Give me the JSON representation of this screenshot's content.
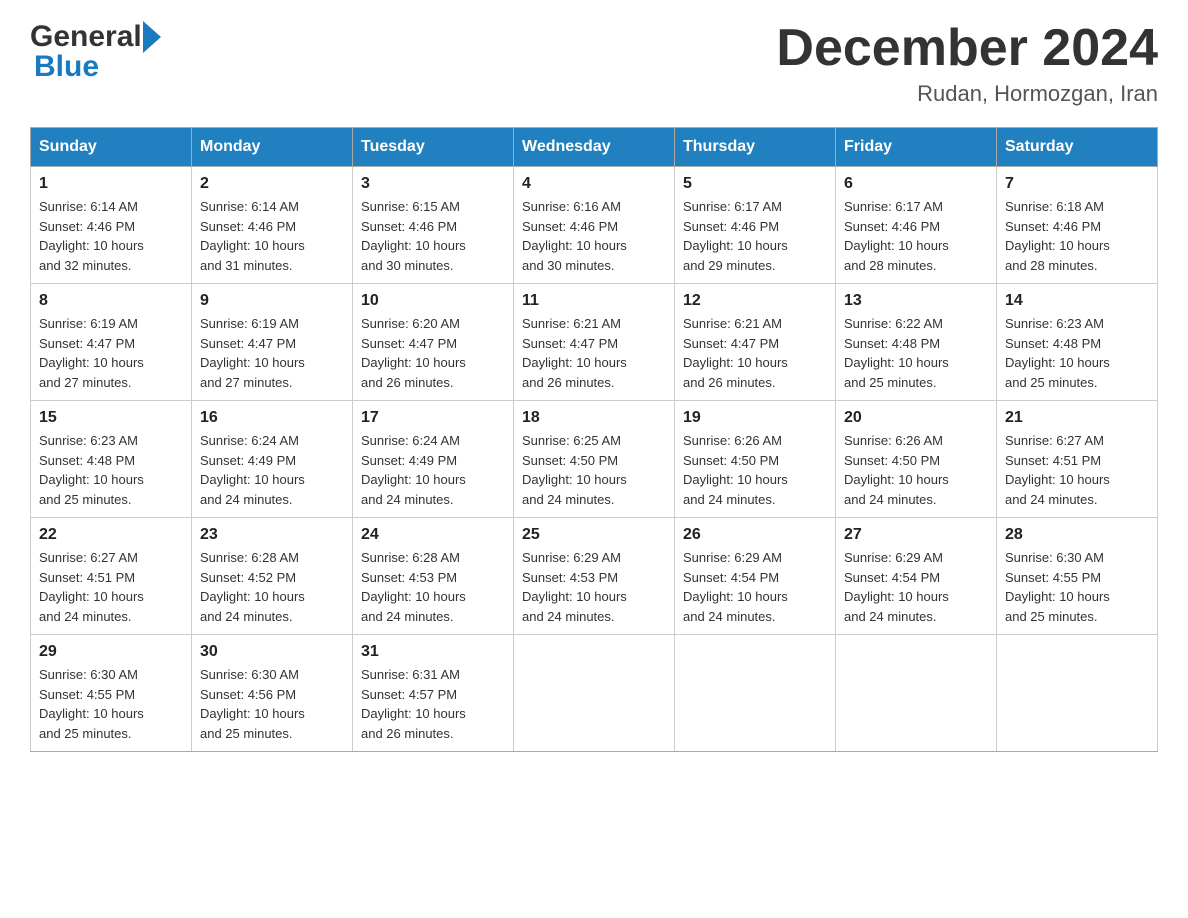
{
  "logo": {
    "general": "General",
    "blue": "Blue"
  },
  "title": {
    "month_year": "December 2024",
    "location": "Rudan, Hormozgan, Iran"
  },
  "weekdays": [
    "Sunday",
    "Monday",
    "Tuesday",
    "Wednesday",
    "Thursday",
    "Friday",
    "Saturday"
  ],
  "weeks": [
    [
      {
        "day": "1",
        "sunrise": "6:14 AM",
        "sunset": "4:46 PM",
        "daylight": "10 hours and 32 minutes."
      },
      {
        "day": "2",
        "sunrise": "6:14 AM",
        "sunset": "4:46 PM",
        "daylight": "10 hours and 31 minutes."
      },
      {
        "day": "3",
        "sunrise": "6:15 AM",
        "sunset": "4:46 PM",
        "daylight": "10 hours and 30 minutes."
      },
      {
        "day": "4",
        "sunrise": "6:16 AM",
        "sunset": "4:46 PM",
        "daylight": "10 hours and 30 minutes."
      },
      {
        "day": "5",
        "sunrise": "6:17 AM",
        "sunset": "4:46 PM",
        "daylight": "10 hours and 29 minutes."
      },
      {
        "day": "6",
        "sunrise": "6:17 AM",
        "sunset": "4:46 PM",
        "daylight": "10 hours and 28 minutes."
      },
      {
        "day": "7",
        "sunrise": "6:18 AM",
        "sunset": "4:46 PM",
        "daylight": "10 hours and 28 minutes."
      }
    ],
    [
      {
        "day": "8",
        "sunrise": "6:19 AM",
        "sunset": "4:47 PM",
        "daylight": "10 hours and 27 minutes."
      },
      {
        "day": "9",
        "sunrise": "6:19 AM",
        "sunset": "4:47 PM",
        "daylight": "10 hours and 27 minutes."
      },
      {
        "day": "10",
        "sunrise": "6:20 AM",
        "sunset": "4:47 PM",
        "daylight": "10 hours and 26 minutes."
      },
      {
        "day": "11",
        "sunrise": "6:21 AM",
        "sunset": "4:47 PM",
        "daylight": "10 hours and 26 minutes."
      },
      {
        "day": "12",
        "sunrise": "6:21 AM",
        "sunset": "4:47 PM",
        "daylight": "10 hours and 26 minutes."
      },
      {
        "day": "13",
        "sunrise": "6:22 AM",
        "sunset": "4:48 PM",
        "daylight": "10 hours and 25 minutes."
      },
      {
        "day": "14",
        "sunrise": "6:23 AM",
        "sunset": "4:48 PM",
        "daylight": "10 hours and 25 minutes."
      }
    ],
    [
      {
        "day": "15",
        "sunrise": "6:23 AM",
        "sunset": "4:48 PM",
        "daylight": "10 hours and 25 minutes."
      },
      {
        "day": "16",
        "sunrise": "6:24 AM",
        "sunset": "4:49 PM",
        "daylight": "10 hours and 24 minutes."
      },
      {
        "day": "17",
        "sunrise": "6:24 AM",
        "sunset": "4:49 PM",
        "daylight": "10 hours and 24 minutes."
      },
      {
        "day": "18",
        "sunrise": "6:25 AM",
        "sunset": "4:50 PM",
        "daylight": "10 hours and 24 minutes."
      },
      {
        "day": "19",
        "sunrise": "6:26 AM",
        "sunset": "4:50 PM",
        "daylight": "10 hours and 24 minutes."
      },
      {
        "day": "20",
        "sunrise": "6:26 AM",
        "sunset": "4:50 PM",
        "daylight": "10 hours and 24 minutes."
      },
      {
        "day": "21",
        "sunrise": "6:27 AM",
        "sunset": "4:51 PM",
        "daylight": "10 hours and 24 minutes."
      }
    ],
    [
      {
        "day": "22",
        "sunrise": "6:27 AM",
        "sunset": "4:51 PM",
        "daylight": "10 hours and 24 minutes."
      },
      {
        "day": "23",
        "sunrise": "6:28 AM",
        "sunset": "4:52 PM",
        "daylight": "10 hours and 24 minutes."
      },
      {
        "day": "24",
        "sunrise": "6:28 AM",
        "sunset": "4:53 PM",
        "daylight": "10 hours and 24 minutes."
      },
      {
        "day": "25",
        "sunrise": "6:29 AM",
        "sunset": "4:53 PM",
        "daylight": "10 hours and 24 minutes."
      },
      {
        "day": "26",
        "sunrise": "6:29 AM",
        "sunset": "4:54 PM",
        "daylight": "10 hours and 24 minutes."
      },
      {
        "day": "27",
        "sunrise": "6:29 AM",
        "sunset": "4:54 PM",
        "daylight": "10 hours and 24 minutes."
      },
      {
        "day": "28",
        "sunrise": "6:30 AM",
        "sunset": "4:55 PM",
        "daylight": "10 hours and 25 minutes."
      }
    ],
    [
      {
        "day": "29",
        "sunrise": "6:30 AM",
        "sunset": "4:55 PM",
        "daylight": "10 hours and 25 minutes."
      },
      {
        "day": "30",
        "sunrise": "6:30 AM",
        "sunset": "4:56 PM",
        "daylight": "10 hours and 25 minutes."
      },
      {
        "day": "31",
        "sunrise": "6:31 AM",
        "sunset": "4:57 PM",
        "daylight": "10 hours and 26 minutes."
      },
      null,
      null,
      null,
      null
    ]
  ],
  "labels": {
    "sunrise": "Sunrise:",
    "sunset": "Sunset:",
    "daylight": "Daylight:"
  }
}
